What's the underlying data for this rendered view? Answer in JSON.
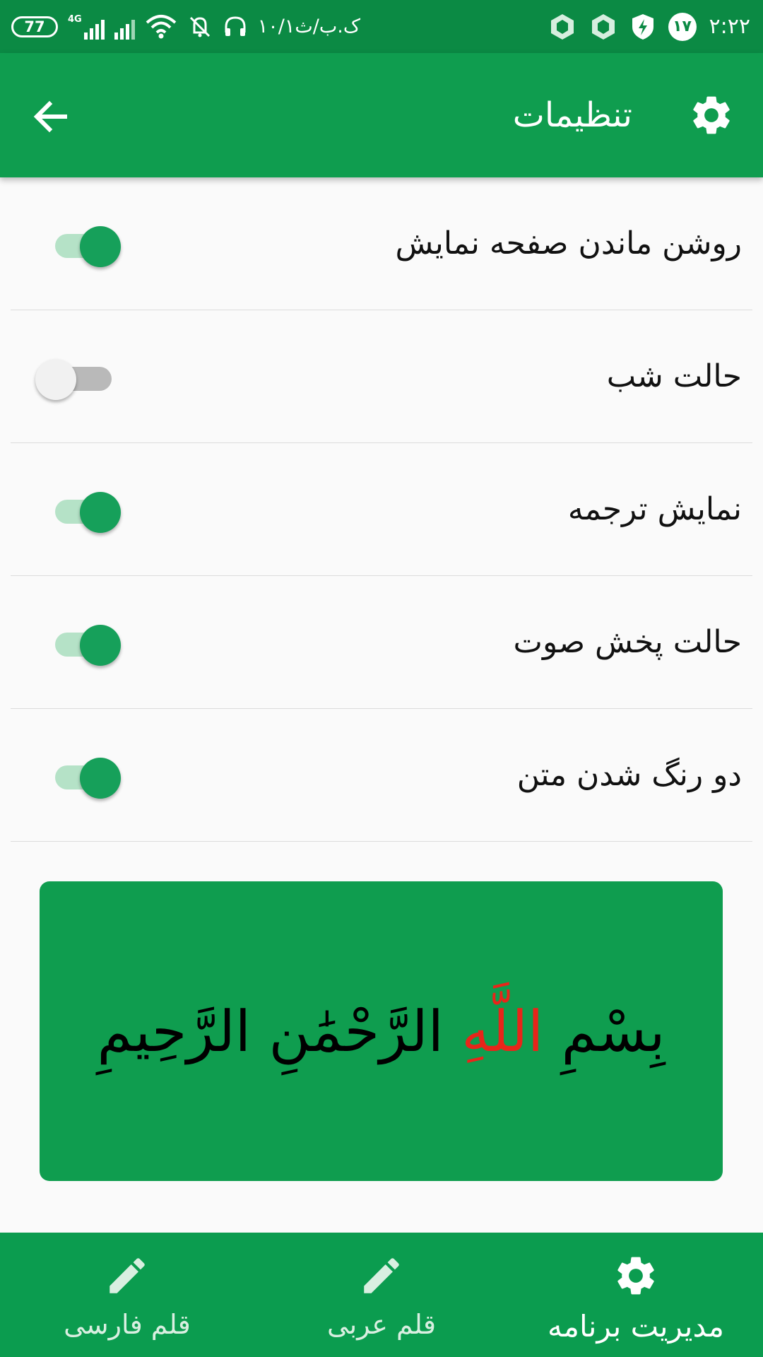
{
  "status_bar": {
    "battery": "77",
    "network": "4G",
    "date": "۱۰/۱ک.ب/ث",
    "day": "۱۷",
    "time": "۲:۲۲"
  },
  "app_bar": {
    "title": "تنظیمات"
  },
  "settings": [
    {
      "label": "روشن ماندن صفحه نمایش",
      "enabled": true
    },
    {
      "label": "حالت شب",
      "enabled": false
    },
    {
      "label": "نمایش ترجمه",
      "enabled": true
    },
    {
      "label": "حالت پخش صوت",
      "enabled": true
    },
    {
      "label": "دو رنگ شدن متن",
      "enabled": true
    }
  ],
  "preview": {
    "part1": "بِسْمِ ",
    "part2": "اللَّهِ",
    "part3": " الرَّحْمَٰنِ الرَّحِيمِ",
    "highlight_color": "#e8251a",
    "background": "#0f9d4f"
  },
  "bottom_nav": {
    "items": [
      {
        "label": "مدیریت برنامه",
        "icon": "gear-icon",
        "active": true
      },
      {
        "label": "قلم عربی",
        "icon": "pencil-icon",
        "active": false
      },
      {
        "label": "قلم فارسی",
        "icon": "pencil-icon",
        "active": false
      }
    ]
  },
  "colors": {
    "primary": "#0f9d4f",
    "primary_dark": "#0b8a44",
    "switch_on": "#16a05a"
  }
}
